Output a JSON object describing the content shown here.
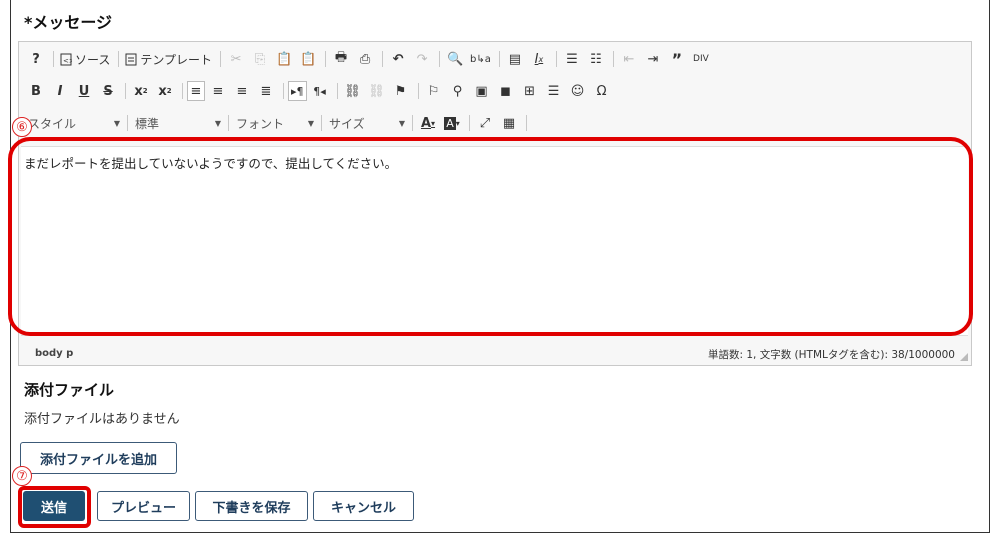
{
  "message_section": {
    "title": "*メッセージ"
  },
  "toolbar": {
    "row1": {
      "source_label": "ソース",
      "template_label": "テンプレート"
    },
    "row3": {
      "style_label": "スタイル",
      "format_label": "標準",
      "font_label": "フォント",
      "size_label": "サイズ"
    }
  },
  "editor": {
    "content": "まだレポートを提出していないようですので、提出してください。",
    "path": "body  p",
    "word_count": "単語数: 1, 文字数 (HTMLタグを含む): 38/1000000"
  },
  "annotations": {
    "marker6": "⑥",
    "marker7": "⑦",
    "highlight_color": "#e00000"
  },
  "attachments": {
    "title": "添付ファイル",
    "empty_text": "添付ファイルはありません",
    "add_button": "添付ファイルを追加"
  },
  "actions": {
    "send": "送信",
    "preview": "プレビュー",
    "save_draft": "下書きを保存",
    "cancel": "キャンセル"
  },
  "colors": {
    "primary_button": "#1f4f72",
    "button_text": "#1f3d5c"
  }
}
